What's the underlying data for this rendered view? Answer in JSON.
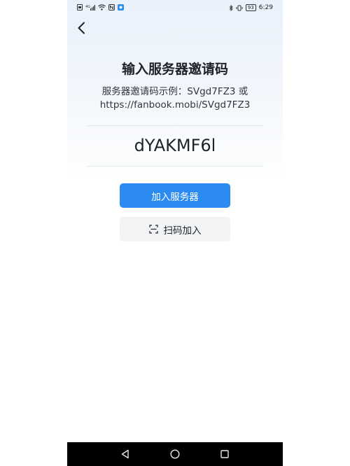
{
  "status_bar": {
    "time": "6:29",
    "battery": "93",
    "signal_text": "4G"
  },
  "header": {
    "back_icon": "chevron-left-icon"
  },
  "main": {
    "title": "输入服务器邀请码",
    "example_line1": "服务器邀请码示例：SVgd7FZ3 或",
    "example_line2": "https://fanbook.mobi/SVgd7FZ3",
    "invite_code_value": "dYAKMF6l",
    "join_button_label": "加入服务器",
    "scan_button_label": "扫码加入",
    "scan_icon": "scan-icon"
  },
  "colors": {
    "primary": "#2c8bf1",
    "secondary_bg": "#f2f3f5",
    "text": "#1f2329"
  },
  "nav_bar": {
    "back": "triangle-back-icon",
    "home": "circle-home-icon",
    "recent": "square-recent-icon"
  }
}
